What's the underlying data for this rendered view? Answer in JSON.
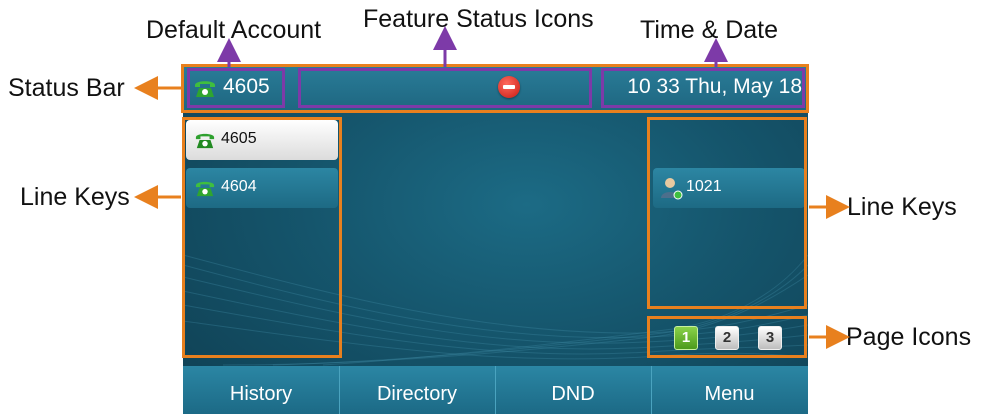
{
  "annotations": {
    "default_account": "Default Account",
    "feature_status_icons": "Feature Status Icons",
    "time_date": "Time & Date",
    "status_bar": "Status Bar",
    "line_keys_left": "Line Keys",
    "line_keys_right": "Line Keys",
    "page_icons": "Page Icons"
  },
  "status_bar": {
    "account": "4605",
    "datetime": "10 33 Thu, May 18",
    "feature_icon": "dnd-icon"
  },
  "left_line_keys": [
    {
      "label": "4605",
      "icon": "phone-icon",
      "state": "selected"
    },
    {
      "label": "4604",
      "icon": "phone-icon",
      "state": "normal"
    }
  ],
  "right_line_keys": [
    {
      "label": "1021",
      "icon": "contact-icon",
      "state": "normal"
    }
  ],
  "pages": [
    "1",
    "2",
    "3"
  ],
  "active_page": "1",
  "softkeys": [
    "History",
    "Directory",
    "DND",
    "Menu"
  ],
  "colors": {
    "annotation_orange": "#e8801e",
    "annotation_purple": "#7d3aa8",
    "screen_bg": "#15556c"
  }
}
